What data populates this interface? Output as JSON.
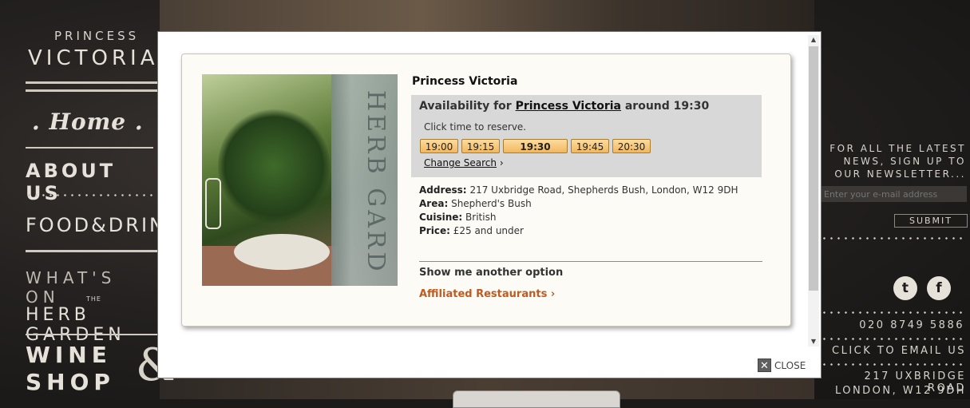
{
  "background": {
    "nav": {
      "brand_top": "PRINCESS",
      "brand_main": "VICTORIA",
      "home": ". Home .",
      "about": "ABOUT US",
      "food": "FOOD&DRINK",
      "whats_on": "WHAT'S ON",
      "herb_small": "THE",
      "herb": "HERB GARDEN",
      "wine": "WINE",
      "shop": "SHOP",
      "amp": "&"
    },
    "sidebar_right": {
      "newsletter": "FOR ALL THE LATEST NEWS, SIGN UP TO OUR NEWSLETTER...",
      "email_placeholder": "Enter your e-mail address",
      "submit": "SUBMIT",
      "twitter": "t",
      "facebook": "f",
      "phone": "020 8749 5886",
      "click_email": "CLICK TO EMAIL US",
      "address_line1": "217 UXBRIDGE ROAD",
      "address_line2": "LONDON, W12 9DH"
    }
  },
  "modal": {
    "restaurant_name": "Princess Victoria",
    "availability_prefix": "Availability for",
    "availability_link": "Princess Victoria",
    "availability_suffix": "around 19:30",
    "click_time": "Click time to reserve.",
    "times": [
      "19:00",
      "19:15",
      "19:30",
      "19:45",
      "20:30"
    ],
    "selected_time": "19:30",
    "change_search": "Change Search",
    "details": {
      "address_label": "Address:",
      "address": "217 Uxbridge Road, Shepherds Bush, London, W12 9DH",
      "area_label": "Area:",
      "area": "Shepherd's Bush",
      "cuisine_label": "Cuisine:",
      "cuisine": "British",
      "price_label": "Price:",
      "price": "£25 and under"
    },
    "another_option": "Show me another option",
    "affiliated": "Affiliated Restaurants ›",
    "close": "CLOSE",
    "photo_glass_text": "HERB GARD"
  },
  "colors": {
    "accent_orange": "#c05a1e",
    "time_button": "#f2b75e",
    "availability_bg": "#d8d8d8"
  }
}
